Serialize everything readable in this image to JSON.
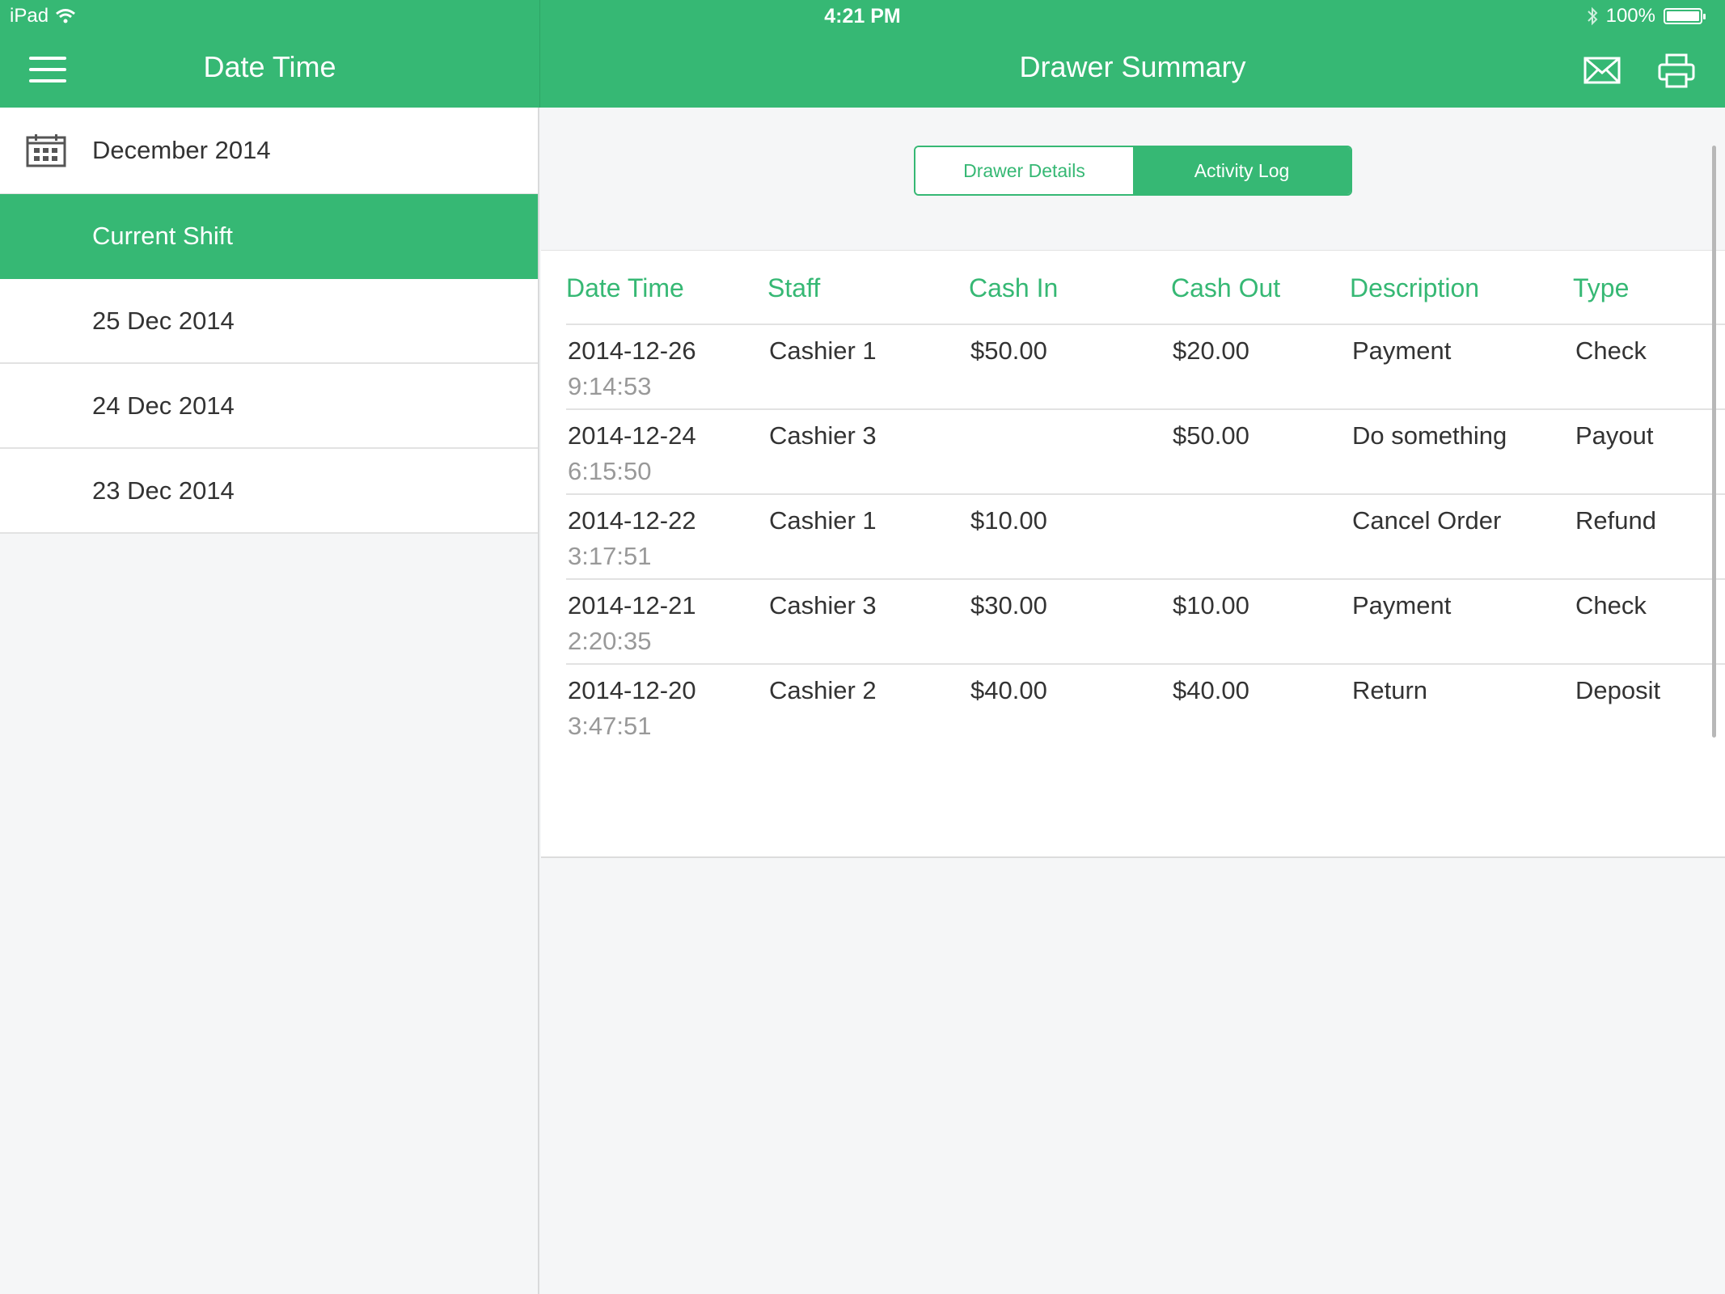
{
  "status_bar": {
    "device": "iPad",
    "time": "4:21 PM",
    "battery": "100%"
  },
  "header": {
    "left_title": "Date Time",
    "right_title": "Drawer Summary",
    "icons": [
      "menu-icon",
      "mail-icon",
      "printer-icon",
      "wifi-icon",
      "bluetooth-icon",
      "battery-icon"
    ]
  },
  "sidebar": {
    "month_label": "December 2014",
    "items": [
      {
        "label": "Current Shift",
        "active": true
      },
      {
        "label": "25 Dec 2014",
        "active": false
      },
      {
        "label": "24 Dec 2014",
        "active": false
      },
      {
        "label": "23 Dec 2014",
        "active": false
      }
    ]
  },
  "tabs": {
    "drawer_details": "Drawer Details",
    "activity_log": "Activity Log",
    "selected": "Activity Log"
  },
  "table": {
    "headers": [
      "Date Time",
      "Staff",
      "Cash In",
      "Cash Out",
      "Description",
      "Type"
    ],
    "rows": [
      {
        "date": "2014-12-26",
        "time": "9:14:53",
        "staff": "Cashier 1",
        "cash_in": "$50.00",
        "cash_out": "$20.00",
        "description": "Payment",
        "type": "Check"
      },
      {
        "date": "2014-12-24",
        "time": "6:15:50",
        "staff": "Cashier 3",
        "cash_in": "",
        "cash_out": "$50.00",
        "description": "Do something",
        "type": "Payout"
      },
      {
        "date": "2014-12-22",
        "time": "3:17:51",
        "staff": "Cashier 1",
        "cash_in": "$10.00",
        "cash_out": "",
        "description": "Cancel Order",
        "type": "Refund"
      },
      {
        "date": "2014-12-21",
        "time": "2:20:35",
        "staff": "Cashier 3",
        "cash_in": "$30.00",
        "cash_out": "$10.00",
        "description": "Payment",
        "type": "Check"
      },
      {
        "date": "2014-12-20",
        "time": "3:47:51",
        "staff": "Cashier 2",
        "cash_in": "$40.00",
        "cash_out": "$40.00",
        "description": "Return",
        "type": "Deposit"
      }
    ]
  },
  "colors": {
    "accent": "#36b874",
    "background": "#f5f6f7",
    "text": "#333333",
    "muted": "#999999"
  }
}
